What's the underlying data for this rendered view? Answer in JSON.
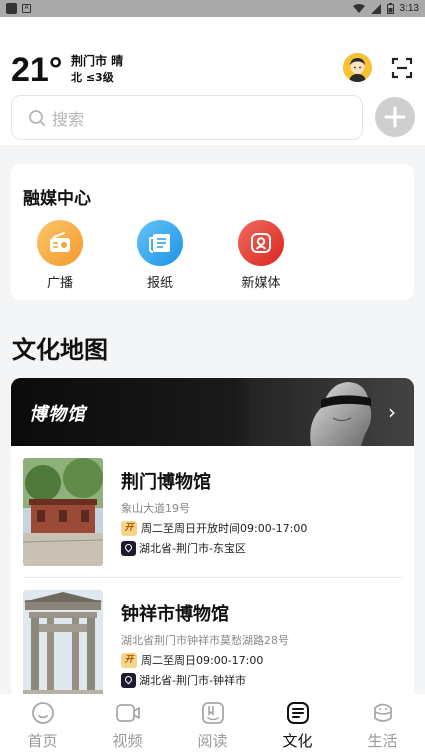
{
  "status_bar": {
    "time": "3:13"
  },
  "weather": {
    "temp": "21°",
    "city_weather": "荆门市 晴",
    "wind": "北 ≤3级"
  },
  "search": {
    "placeholder": "搜索"
  },
  "media_center": {
    "title": "融媒中心",
    "items": [
      {
        "label": "广播",
        "icon": "radio-icon",
        "color": "#f5a53a"
      },
      {
        "label": "报纸",
        "icon": "newspaper-icon",
        "color": "#2fa5ee"
      },
      {
        "label": "新媒体",
        "icon": "new-media-icon",
        "color": "#e8362f"
      }
    ]
  },
  "culture_map": {
    "title": "文化地图",
    "banner_title": "博物馆",
    "museums": [
      {
        "name": "荆门博物馆",
        "address": "象山大道19号",
        "open_badge": "开",
        "hours": "周二至周日开放时间09:00-17:00",
        "region": "湖北省-荆门市-东宝区"
      },
      {
        "name": "钟祥市博物馆",
        "address": "湖北省荆门市钟祥市莫愁湖路28号",
        "open_badge": "开",
        "hours": "周二至周日09:00-17:00",
        "region": "湖北省-荆门市-钟祥市"
      }
    ]
  },
  "tabbar": {
    "tabs": [
      {
        "label": "首页",
        "icon": "home-icon",
        "active": false
      },
      {
        "label": "视频",
        "icon": "video-icon",
        "active": false
      },
      {
        "label": "阅读",
        "icon": "reading-icon",
        "active": false
      },
      {
        "label": "文化",
        "icon": "culture-icon",
        "active": true
      },
      {
        "label": "生活",
        "icon": "life-icon",
        "active": false
      }
    ]
  }
}
